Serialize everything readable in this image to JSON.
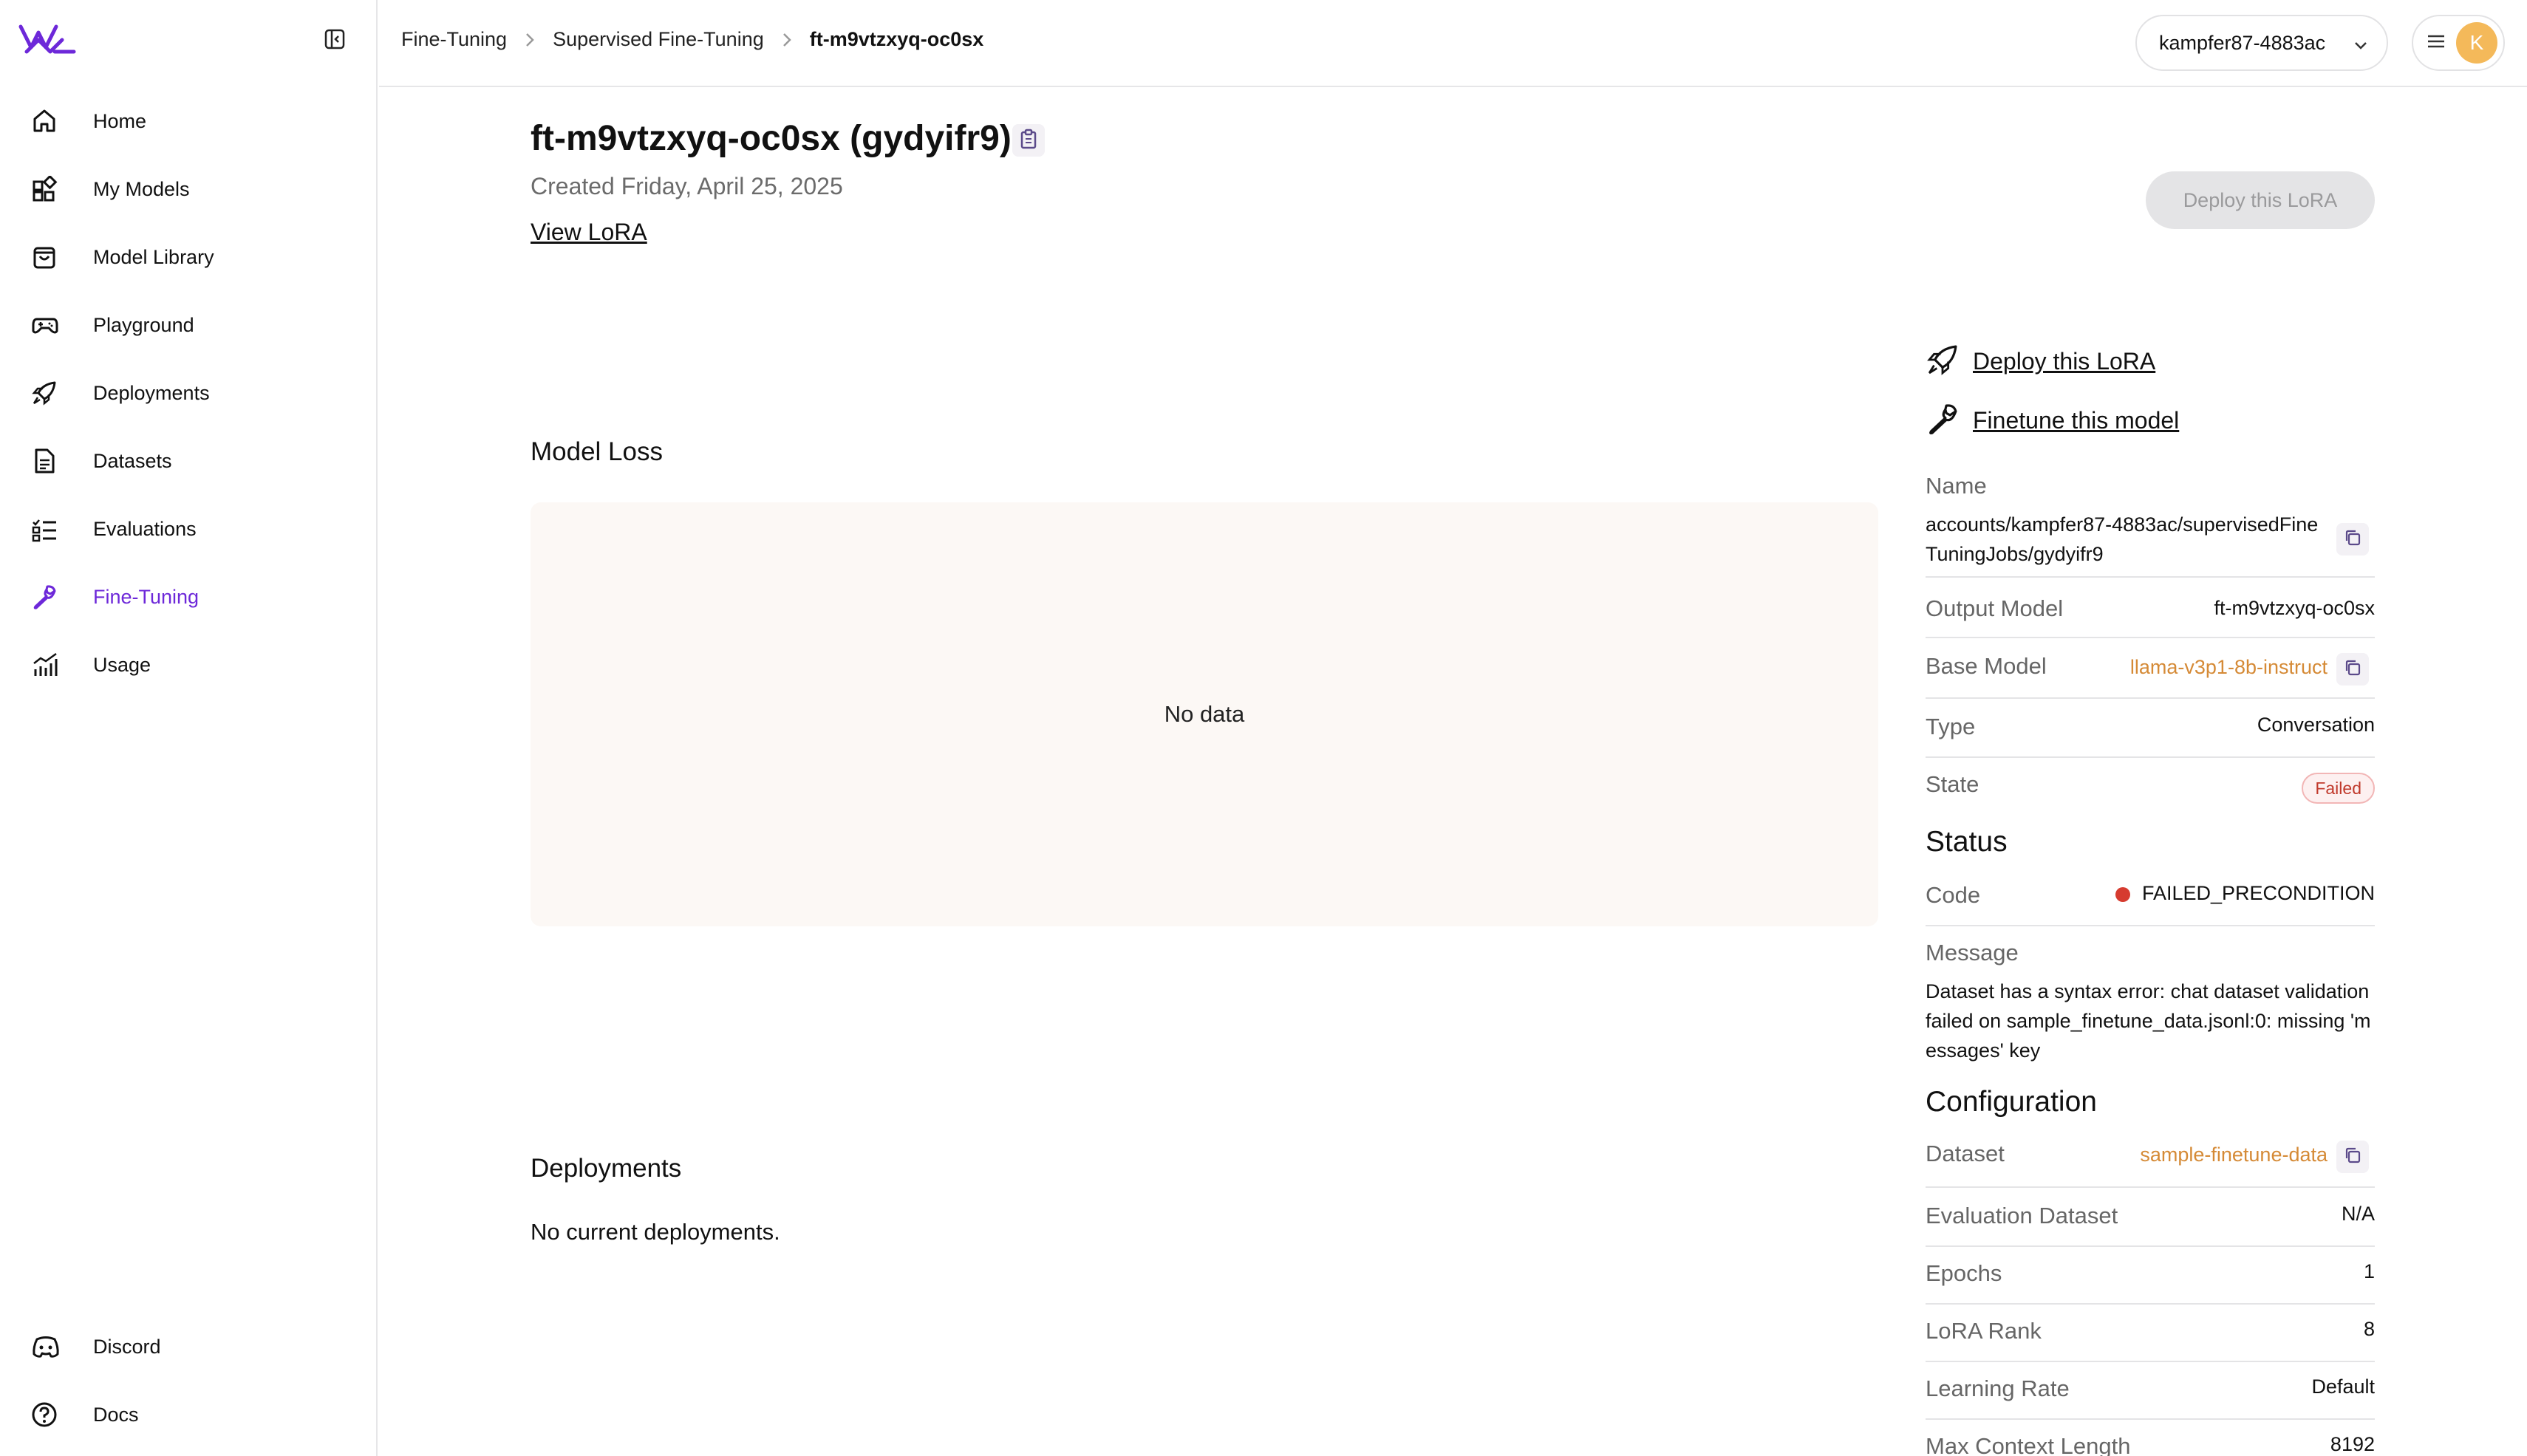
{
  "sidebar": {
    "logo_icon": "fireworks-logo-icon",
    "items": [
      {
        "label": "Home",
        "icon": "home-icon"
      },
      {
        "label": "My Models",
        "icon": "models-icon"
      },
      {
        "label": "Model Library",
        "icon": "library-bag-icon"
      },
      {
        "label": "Playground",
        "icon": "gamepad-icon"
      },
      {
        "label": "Deployments",
        "icon": "rocket-icon"
      },
      {
        "label": "Datasets",
        "icon": "document-icon"
      },
      {
        "label": "Evaluations",
        "icon": "checklist-icon"
      },
      {
        "label": "Fine-Tuning",
        "icon": "wrench-icon",
        "active": true
      },
      {
        "label": "Usage",
        "icon": "chart-icon"
      }
    ],
    "footer": [
      {
        "label": "Discord",
        "icon": "discord-icon"
      },
      {
        "label": "Docs",
        "icon": "help-icon"
      }
    ]
  },
  "breadcrumb": [
    "Fine-Tuning",
    "Supervised Fine-Tuning",
    "ft-m9vtzxyq-oc0sx"
  ],
  "account": {
    "name": "kampfer87-4883ac",
    "avatar_letter": "K"
  },
  "job": {
    "title": "ft-m9vtzxyq-oc0sx (gydyifr9)",
    "created": "Created Friday, April 25, 2025",
    "view_lora": "View LoRA",
    "deploy_button": "Deploy this LoRA"
  },
  "model_loss": {
    "heading": "Model Loss",
    "empty": "No data"
  },
  "deployments": {
    "heading": "Deployments",
    "empty": "No current deployments."
  },
  "panel": {
    "actions": {
      "deploy": "Deploy this LoRA",
      "finetune": "Finetune this model"
    },
    "name_label": "Name",
    "name_value_line1": "accounts/kampfer87-4883ac/supervisedFine",
    "name_value_line2": "TuningJobs/gydyifr9",
    "output_model_label": "Output Model",
    "output_model_value": "ft-m9vtzxyq-oc0sx",
    "base_model_label": "Base Model",
    "base_model_value": "llama-v3p1-8b-instruct",
    "type_label": "Type",
    "type_value": "Conversation",
    "state_label": "State",
    "state_value": "Failed",
    "status_heading": "Status",
    "code_label": "Code",
    "code_value": "FAILED_PRECONDITION",
    "message_label": "Message",
    "message_line1": "Dataset has a syntax error: chat dataset validation",
    "message_line2": "failed on sample_finetune_data.jsonl:0: missing 'm",
    "message_line3": "essages' key",
    "config_heading": "Configuration",
    "dataset_label": "Dataset",
    "dataset_value": "sample-finetune-data",
    "eval_dataset_label": "Evaluation Dataset",
    "eval_dataset_value": "N/A",
    "epochs_label": "Epochs",
    "epochs_value": "1",
    "lora_rank_label": "LoRA Rank",
    "lora_rank_value": "8",
    "learning_rate_label": "Learning Rate",
    "learning_rate_value": "Default",
    "max_context_label": "Max Context Length",
    "max_context_value": "8192"
  },
  "colors": {
    "accent": "#6d28d9",
    "link_orange": "#d58a36",
    "failed_red": "#c0392b"
  }
}
